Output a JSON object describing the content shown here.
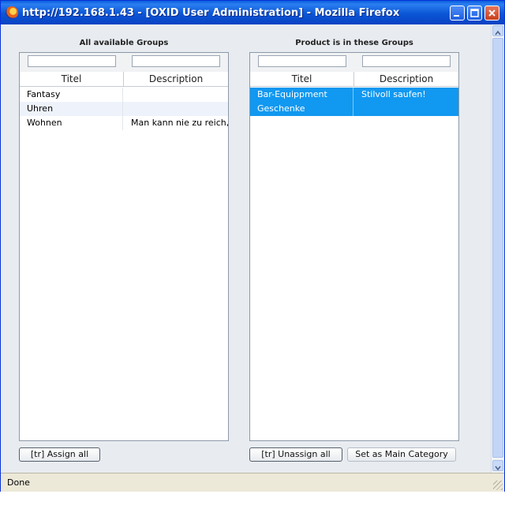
{
  "window": {
    "title": "http://192.168.1.43 - [OXID User Administration] - Mozilla Firefox",
    "status": "Done"
  },
  "left": {
    "heading": "All available Groups",
    "filter_values": [
      "",
      ""
    ],
    "columns": [
      "Titel",
      "Description"
    ],
    "rows": [
      {
        "titel": "Fantasy",
        "description": ""
      },
      {
        "titel": "Uhren",
        "description": ""
      },
      {
        "titel": "Wohnen",
        "description": "Man kann nie zu reich,"
      }
    ],
    "assign_all_label": "[tr] Assign all"
  },
  "right": {
    "heading": "Product is in these Groups",
    "filter_values": [
      "",
      ""
    ],
    "columns": [
      "Titel",
      "Description"
    ],
    "rows": [
      {
        "titel": "Bar-Equippment",
        "description": "Stilvoll saufen!",
        "selected": true
      },
      {
        "titel": "Geschenke",
        "description": "",
        "selected": true
      }
    ],
    "unassign_all_label": "[tr] Unassign all",
    "set_main_label": "Set as Main Category"
  },
  "colors": {
    "selection": "#1198f0",
    "titlebar": "#0b56d6"
  }
}
